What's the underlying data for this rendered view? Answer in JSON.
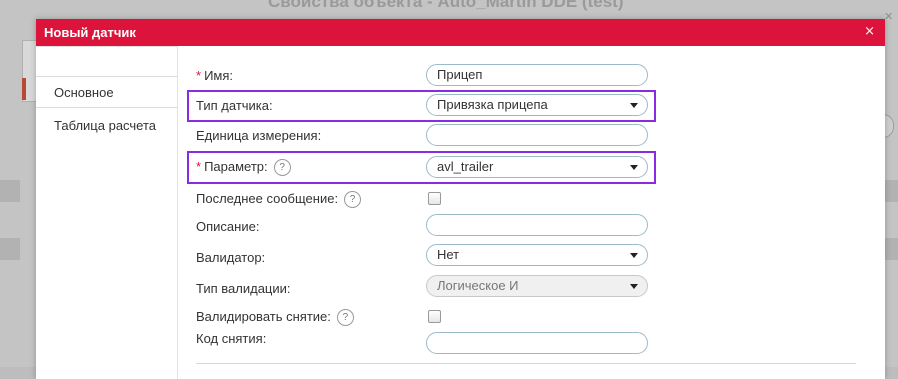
{
  "background": {
    "title": "Свойства объекта - Auto_Martin DDE (test)"
  },
  "dialog": {
    "title": "Новый датчик",
    "close_glyph": "×",
    "accent_color": "#dc143c"
  },
  "tabs": [
    {
      "label": "Основное",
      "active": true
    },
    {
      "label": "Таблица расчета",
      "active": false
    }
  ],
  "form": {
    "name": {
      "label": "Имя:",
      "required": true,
      "value": "Прицеп"
    },
    "sensor_type": {
      "label": "Тип датчика:",
      "value": "Привязка прицепа"
    },
    "unit": {
      "label": "Единица измерения:",
      "value": ""
    },
    "parameter": {
      "label": "Параметр:",
      "required": true,
      "value": "avl_trailer",
      "help": "?"
    },
    "last_message": {
      "label": "Последнее сообщение:",
      "help": "?",
      "checked": false
    },
    "description": {
      "label": "Описание:",
      "value": ""
    },
    "validator": {
      "label": "Валидатор:",
      "value": "Нет"
    },
    "validation_type": {
      "label": "Тип валидации:",
      "value": "Логическое И",
      "disabled": true
    },
    "validate_unbind": {
      "label": "Валидировать снятие:",
      "help": "?",
      "checked": false
    },
    "unbind_code": {
      "label": "Код снятия:",
      "value": ""
    }
  },
  "highlight_color": "#8a2be2"
}
